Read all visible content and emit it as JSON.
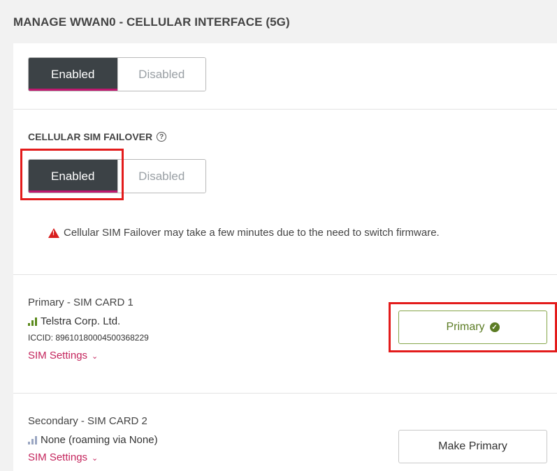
{
  "header": {
    "title": "MANAGE WWAN0 - CELLULAR INTERFACE (5G)"
  },
  "interface_toggle": {
    "enabled_label": "Enabled",
    "disabled_label": "Disabled",
    "selected": "Enabled"
  },
  "failover": {
    "title": "CELLULAR SIM FAILOVER",
    "help_icon": "help-circle-icon",
    "toggle": {
      "enabled_label": "Enabled",
      "disabled_label": "Disabled",
      "selected": "Enabled"
    },
    "warning": "Cellular SIM Failover may take a few minutes due to the need to switch firmware.",
    "warning_icon": "warning-triangle-icon"
  },
  "sims": [
    {
      "title": "Primary - SIM CARD 1",
      "carrier": "Telstra Corp. Ltd.",
      "signal_icon": "signal-strong-icon",
      "iccid": "ICCID: 89610180004500368229",
      "settings_label": "SIM Settings",
      "button_label": "Primary",
      "button_icon": "check-circle-icon"
    },
    {
      "title": "Secondary - SIM CARD 2",
      "carrier": "None (roaming via None)",
      "signal_icon": "signal-none-icon",
      "settings_label": "SIM Settings",
      "button_label": "Make Primary"
    }
  ],
  "colors": {
    "toggle_on_bg": "#3c4246",
    "toggle_underline": "#c0186f",
    "link": "#c4245c",
    "primary_green": "#5c7c24",
    "highlight_red": "#e31b1b"
  }
}
